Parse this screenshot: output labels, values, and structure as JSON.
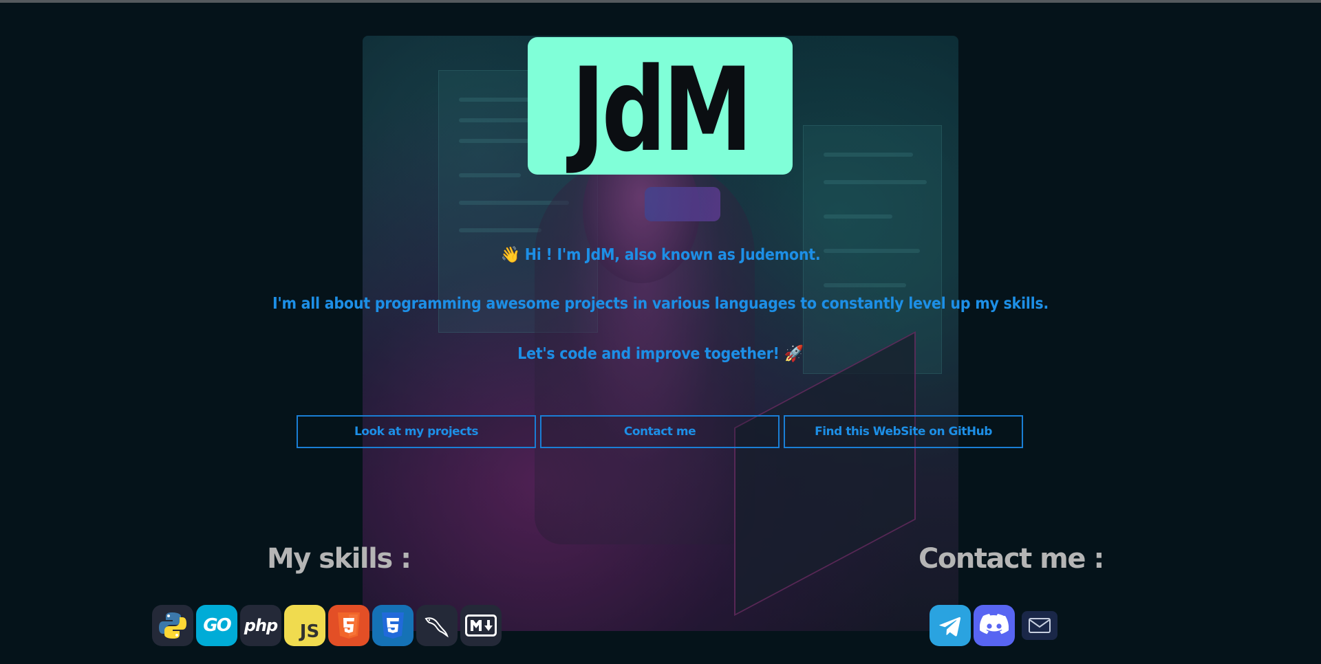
{
  "logo": {
    "text": "JdM"
  },
  "intro": {
    "line1": "👋 Hi ! I'm JdM, also known as Judemont.",
    "line2": "I'm all about programming awesome projects in various languages to constantly level up my skills.",
    "line3": "Let's code and improve together! 🚀"
  },
  "buttons": {
    "projects": "Look at my projects",
    "contact": "Contact me",
    "github": "Find this WebSite on GitHub"
  },
  "skills": {
    "title": "My skills :",
    "icons": [
      "python-icon",
      "go-icon",
      "php-icon",
      "javascript-icon",
      "html5-icon",
      "css3-icon",
      "mysql-icon",
      "markdown-icon"
    ],
    "go_label": "GO",
    "php_label": "php",
    "js_label": "JS"
  },
  "contact": {
    "title": "Contact me :",
    "icons": [
      "telegram-icon",
      "discord-icon",
      "mail-icon"
    ]
  },
  "colors": {
    "background": "#05131a",
    "logo_bg": "#80ffd8",
    "accent_text": "#1d8fe6",
    "heading_gray": "#b5b5b5"
  }
}
